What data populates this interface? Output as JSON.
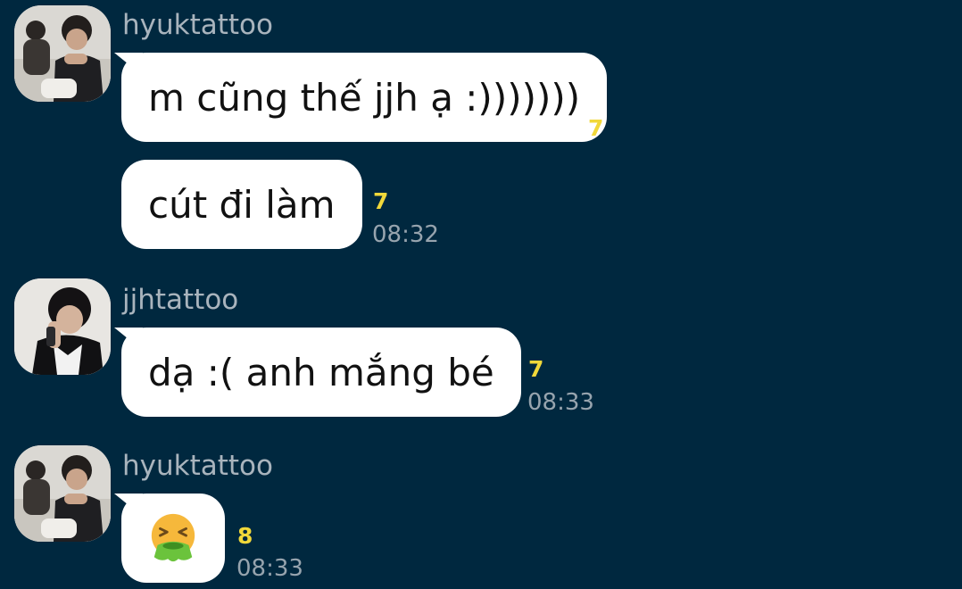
{
  "colors": {
    "background": "#00283f",
    "bubble": "#ffffff",
    "sender_name": "#a9b4bd",
    "read_count": "#f1d83a",
    "timestamp": "#97a4ae"
  },
  "groups": [
    {
      "sender": "hyuktattoo",
      "avatar": "profile-photo",
      "messages": [
        {
          "text": "m cũng thế jjh ạ :)))))))",
          "read_count": "7",
          "time": ""
        },
        {
          "text": "cút đi làm",
          "read_count": "7",
          "time": "08:32"
        }
      ]
    },
    {
      "sender": "jjhtattoo",
      "avatar": "profile-photo",
      "messages": [
        {
          "text": "dạ :( anh mắng bé",
          "read_count": "7",
          "time": "08:33"
        }
      ]
    },
    {
      "sender": "hyuktattoo",
      "avatar": "profile-photo",
      "messages": [
        {
          "emoji": "nauseated-face-emoji",
          "read_count": "8",
          "time": "08:33"
        }
      ]
    }
  ]
}
